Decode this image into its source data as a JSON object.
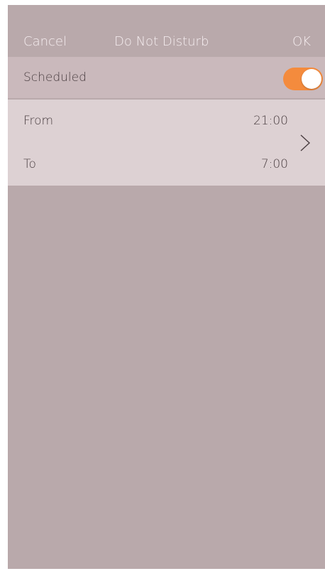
{
  "navbar": {
    "cancel_label": "Cancel",
    "title": "Do Not Disturb",
    "ok_label": "OK"
  },
  "scheduled": {
    "label": "Scheduled",
    "enabled": true,
    "toggle_color": "#f48b3d"
  },
  "schedule": {
    "from_label": "From",
    "from_value": "21:00",
    "to_label": "To",
    "to_value": "7:00",
    "chevron_icon": "chevron-right-icon"
  }
}
